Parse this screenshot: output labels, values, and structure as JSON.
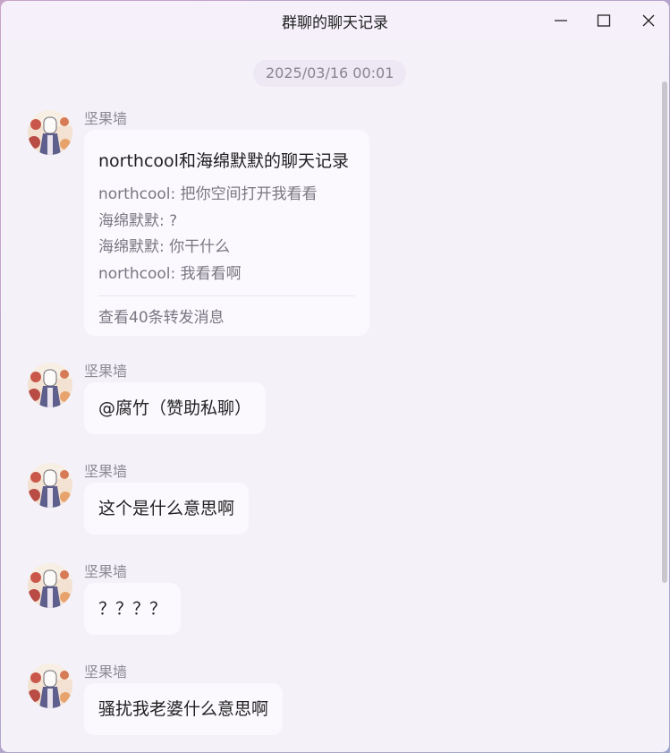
{
  "window": {
    "title": "群聊的聊天记录",
    "controls": [
      "minimize-icon",
      "maximize-icon",
      "close-icon"
    ]
  },
  "timestamp": "2025/03/16 00:01",
  "messages": [
    {
      "sender": "坚果墙",
      "type": "forwarded",
      "forward": {
        "title": "northcool和海绵默默的聊天记录",
        "lines": [
          "northcool: 把你空间打开我看看",
          "海绵默默: ?",
          "海绵默默: 你干什么",
          "northcool: 我看看啊"
        ],
        "footer": "查看40条转发消息"
      }
    },
    {
      "sender": "坚果墙",
      "type": "text",
      "text": "@腐竹（赞助私聊）"
    },
    {
      "sender": "坚果墙",
      "type": "text",
      "text": "这个是什么意思啊"
    },
    {
      "sender": "坚果墙",
      "type": "text",
      "text": "？？？？"
    },
    {
      "sender": "坚果墙",
      "type": "text",
      "text": "骚扰我老婆什么意思啊"
    }
  ],
  "colors": {
    "background": "#f4f1f9",
    "bubble": "#fbf8fe",
    "accent": "#c8a3c9"
  }
}
